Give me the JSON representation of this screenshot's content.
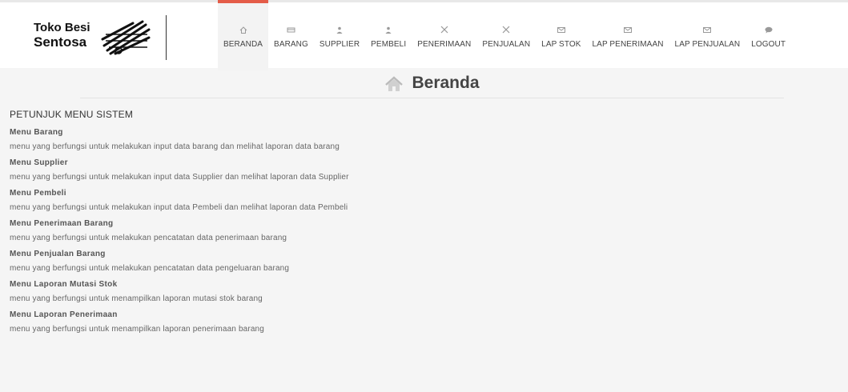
{
  "logo": {
    "line1": "Toko Besi",
    "line2": "Sentosa"
  },
  "nav": [
    {
      "label": "BERANDA",
      "icon": "home-icon",
      "active": true
    },
    {
      "label": "BARANG",
      "icon": "box-icon",
      "active": false
    },
    {
      "label": "SUPPLIER",
      "icon": "user-icon",
      "active": false
    },
    {
      "label": "PEMBELI",
      "icon": "user-icon",
      "active": false
    },
    {
      "label": "PENERIMAAN",
      "icon": "tools-icon",
      "active": false
    },
    {
      "label": "PENJUALAN",
      "icon": "tools-icon",
      "active": false
    },
    {
      "label": "LAP STOK",
      "icon": "mail-icon",
      "active": false
    },
    {
      "label": "LAP PENERIMAAN",
      "icon": "mail-icon",
      "active": false
    },
    {
      "label": "LAP PENJUALAN",
      "icon": "mail-icon",
      "active": false
    },
    {
      "label": "LOGOUT",
      "icon": "comment-icon",
      "active": false
    }
  ],
  "page": {
    "title": "Beranda",
    "title_icon": "home-icon"
  },
  "content": {
    "heading": "PETUNJUK MENU SISTEM",
    "menus": [
      {
        "title": "Menu Barang",
        "desc": "menu yang berfungsi untuk melakukan input data barang dan melihat laporan data barang"
      },
      {
        "title": "Menu Supplier",
        "desc": "menu yang berfungsi untuk melakukan input data Supplier dan melihat laporan data Supplier"
      },
      {
        "title": "Menu Pembeli",
        "desc": "menu yang berfungsi untuk melakukan input data Pembeli dan melihat laporan data Pembeli"
      },
      {
        "title": "Menu Penerimaan Barang",
        "desc": "menu yang berfungsi untuk melakukan pencatatan data penerimaan barang"
      },
      {
        "title": "Menu Penjualan Barang",
        "desc": "menu yang berfungsi untuk melakukan pencatatan data pengeluaran barang"
      },
      {
        "title": "Menu Laporan Mutasi Stok",
        "desc": "menu yang berfungsi untuk menampilkan laporan mutasi stok barang"
      },
      {
        "title": "Menu Laporan Penerimaan",
        "desc": "menu yang berfungsi untuk menampilkan laporan penerimaan barang"
      }
    ]
  },
  "colors": {
    "accent": "#e45c48",
    "background": "#f5f5f5"
  }
}
